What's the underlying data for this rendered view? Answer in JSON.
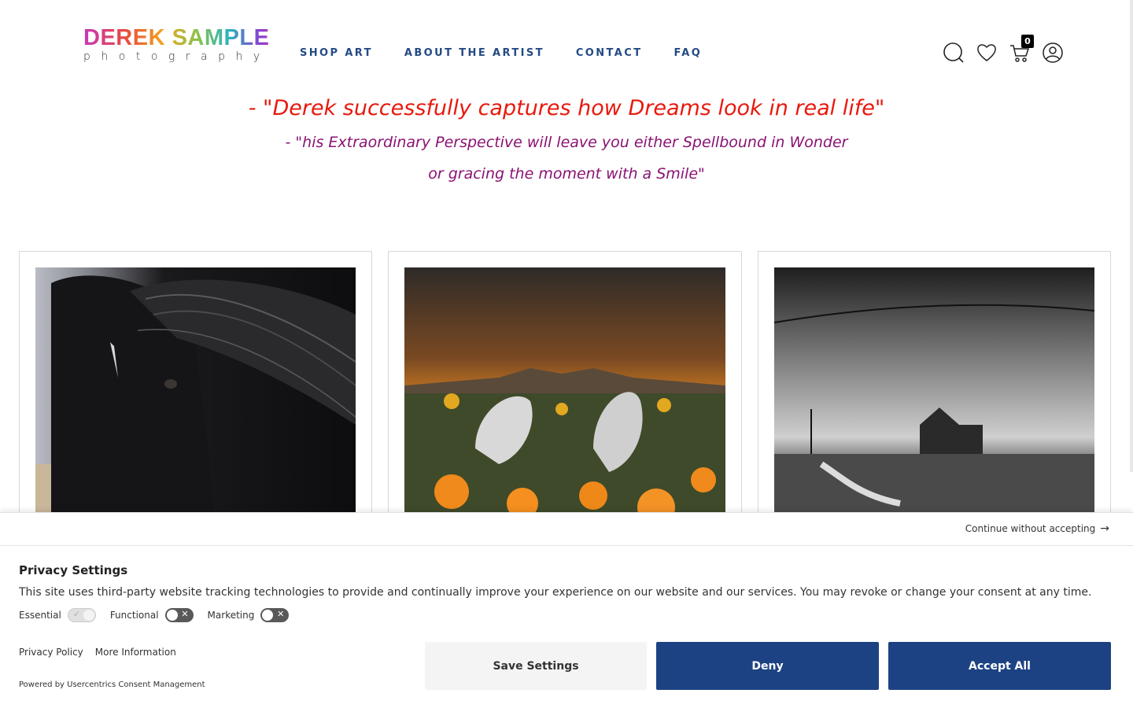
{
  "header": {
    "logo_main": "DEREK SAMPLE",
    "logo_sub": "photography",
    "nav": [
      "SHOP ART",
      "ABOUT THE ARTIST",
      "CONTACT",
      "FAQ"
    ],
    "icons": [
      "search-icon",
      "heart-icon",
      "cart-icon",
      "user-icon"
    ],
    "cart_count": "0"
  },
  "quotes": {
    "line1": "- \"Derek successfully captures how Dreams look in real life\"",
    "line2": "- \"his Extraordinary Perspective will leave you either Spellbound in Wonder",
    "line3": "or gracing the moment with a Smile\""
  },
  "colors": {
    "nav": "#244a84",
    "quote1": "#e8190d",
    "quote2": "#8a1273",
    "button_primary": "#1d4283",
    "button_secondary": "#f4f4f4"
  },
  "consent": {
    "continue_label": "Continue without accepting",
    "title": "Privacy Settings",
    "description": "This site uses third-party website tracking technologies to provide and continually improve your experience on our website and our services. You may revoke or change your consent at any time.",
    "toggles": [
      {
        "label": "Essential",
        "state": "on"
      },
      {
        "label": "Functional",
        "state": "off"
      },
      {
        "label": "Marketing",
        "state": "off"
      }
    ],
    "links": [
      "Privacy Policy",
      "More Information"
    ],
    "powered_by": "Powered by Usercentrics Consent Management",
    "buttons": {
      "save": "Save Settings",
      "deny": "Deny",
      "accept": "Accept All"
    }
  }
}
